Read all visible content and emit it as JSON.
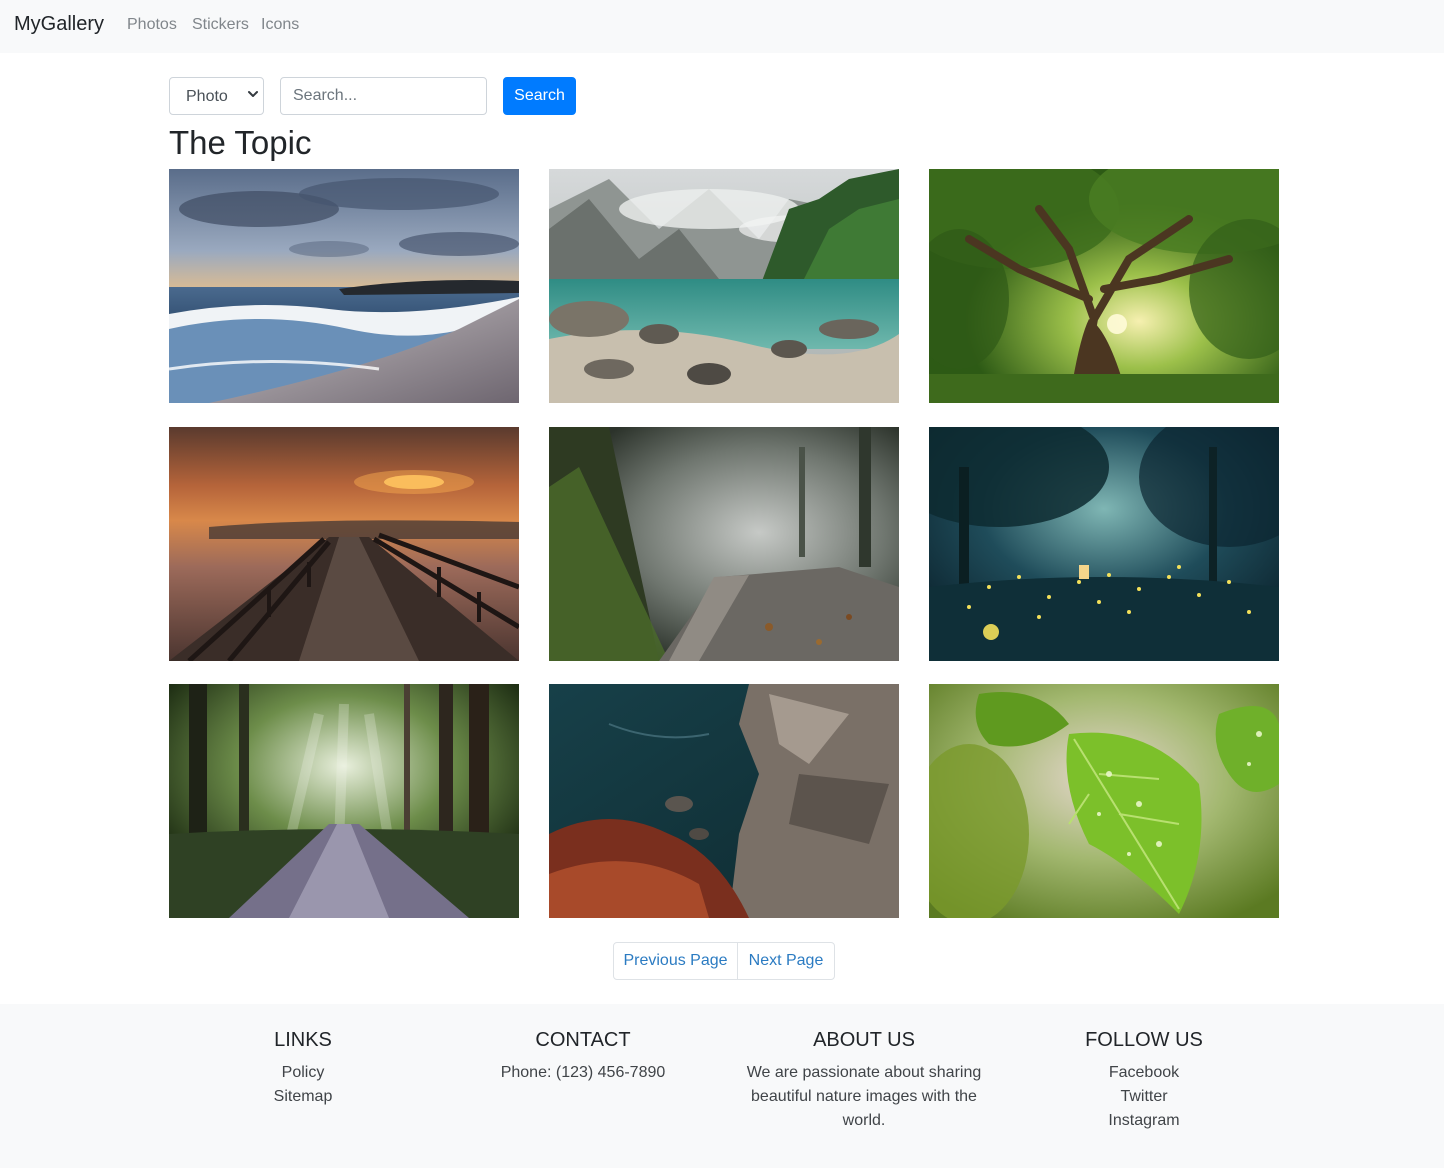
{
  "navbar": {
    "brand": "MyGallery",
    "links": [
      "Photos",
      "Stickers",
      "Icons"
    ]
  },
  "search": {
    "type_value": "Photo",
    "placeholder": "Search...",
    "button_label": "Search"
  },
  "page_title": "The Topic",
  "gallery": {
    "images": [
      "beach-sunset",
      "mountain-lake",
      "giant-tree",
      "misty-pier-sunrise",
      "foggy-forest-path",
      "fireflies-forest",
      "sunlit-forest-road",
      "rocky-coast",
      "leaves-with-raindrops"
    ]
  },
  "pagination": {
    "prev_label": "Previous Page",
    "next_label": "Next Page"
  },
  "footer": {
    "links": {
      "heading": "LINKS",
      "items": [
        "Policy",
        "Sitemap"
      ]
    },
    "contact": {
      "heading": "CONTACT",
      "phone": "Phone: (123) 456-7890"
    },
    "about": {
      "heading": "ABOUT US",
      "text": "We are passionate about sharing beautiful nature images with the world."
    },
    "follow": {
      "heading": "FOLLOW US",
      "items": [
        "Facebook",
        "Twitter",
        "Instagram"
      ]
    }
  },
  "colors": {
    "primary": "#007bff",
    "link": "#2b7bc2",
    "navbar_bg": "#f8f9fa",
    "footer_bg": "#f8f9fa"
  }
}
